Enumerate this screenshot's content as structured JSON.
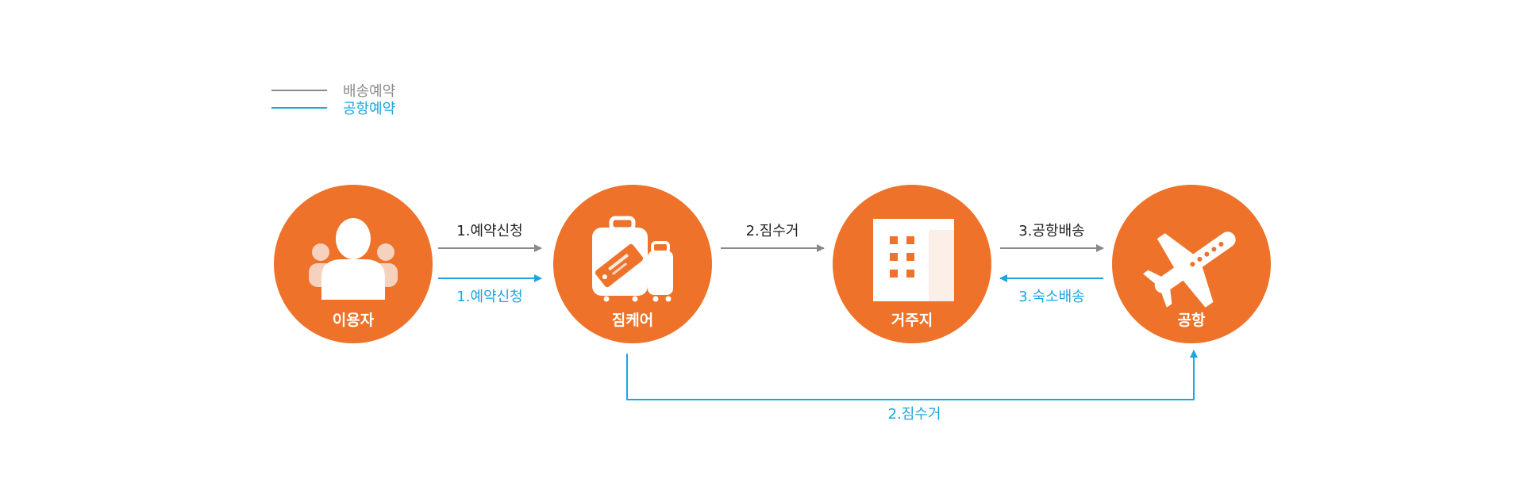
{
  "colors": {
    "node": "#EE7229",
    "delivery": "#8A8A8A",
    "airport": "#1AA6E2",
    "edge_text": "#222222",
    "icon": "#ffffff",
    "icon_person_side": "#F6D2BE"
  },
  "legend": [
    {
      "key": "delivery",
      "label": "배송예약"
    },
    {
      "key": "airport",
      "label": "공항예약"
    }
  ],
  "nodes": [
    {
      "id": "user",
      "label": "이용자",
      "icon": "users-icon"
    },
    {
      "id": "jimcarrier",
      "label": "짐케어",
      "icon": "luggage-icon"
    },
    {
      "id": "residence",
      "label": "거주지",
      "icon": "building-icon"
    },
    {
      "id": "airport",
      "label": "공항",
      "icon": "airplane-icon"
    }
  ],
  "edges": [
    {
      "from": "user",
      "to": "jimcarrier",
      "type": "delivery",
      "label": "1.예약신청"
    },
    {
      "from": "user",
      "to": "jimcarrier",
      "type": "airport",
      "label": "1.예약신청"
    },
    {
      "from": "jimcarrier",
      "to": "residence",
      "type": "delivery",
      "label": "2.짐수거"
    },
    {
      "from": "residence",
      "to": "airport",
      "type": "delivery",
      "label": "3.공항배송"
    },
    {
      "from": "airport",
      "to": "residence",
      "type": "airport",
      "label": "3.숙소배송"
    },
    {
      "from": "jimcarrier",
      "to": "airport",
      "type": "airport",
      "label": "2.짐수거"
    }
  ]
}
